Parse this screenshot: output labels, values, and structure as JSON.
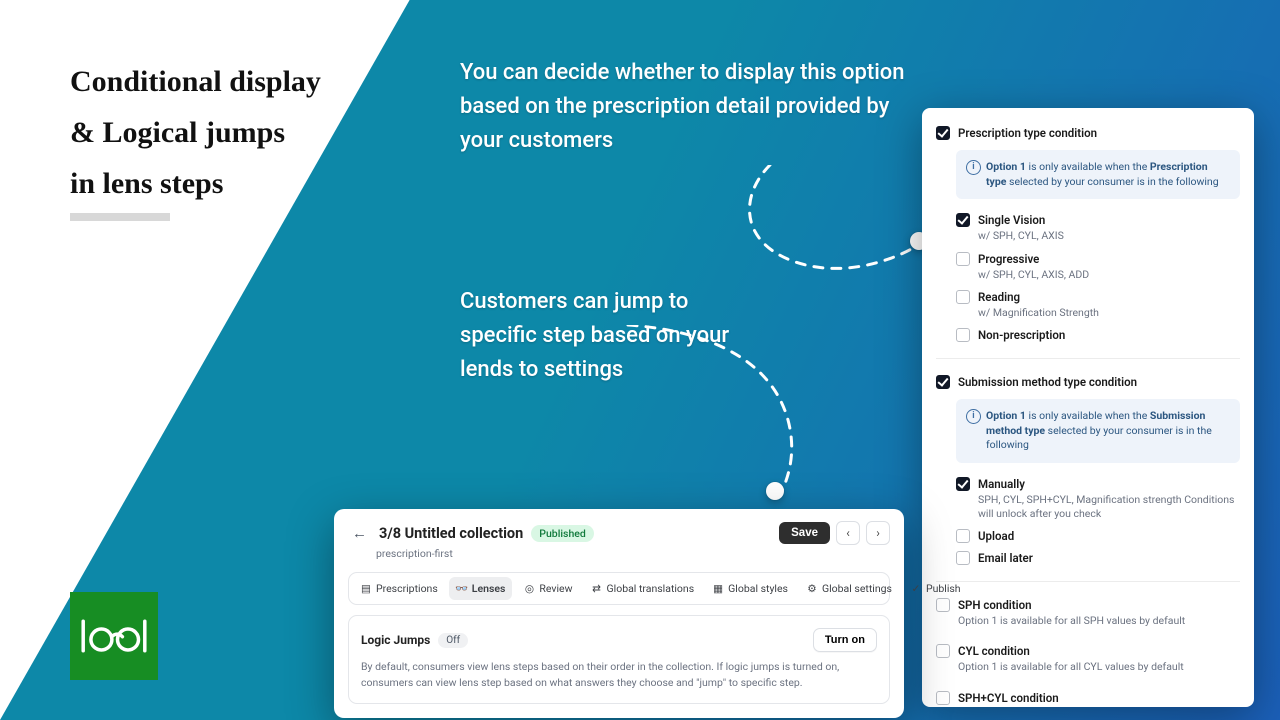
{
  "hero": {
    "title_l1": "Conditional display",
    "title_l2": "& Logical jumps",
    "title_l3": "in lens steps",
    "annot1": "You can decide whether to display this option based on the prescription detail provided by your customers",
    "annot2": "Customers can jump to specific step based on your lends to settings"
  },
  "conditions": {
    "presc_label": "Prescription type condition",
    "presc_info_before": "Option 1",
    "presc_info_mid": " is only available when the ",
    "presc_info_bold": "Prescription type",
    "presc_info_after": " selected by your consumer is in the following",
    "items": [
      {
        "label": "Single Vision",
        "sub": "w/ SPH, CYL, AXIS",
        "checked": true
      },
      {
        "label": "Progressive",
        "sub": "w/ SPH, CYL, AXIS, ADD",
        "checked": false
      },
      {
        "label": "Reading",
        "sub": "w/ Magnification Strength",
        "checked": false
      },
      {
        "label": "Non-prescription",
        "sub": "",
        "checked": false
      }
    ],
    "submit_label": "Submission method type condition",
    "submit_info_before": "Option 1",
    "submit_info_mid": " is only available when the ",
    "submit_info_bold": "Submission method type",
    "submit_info_after": " selected by your consumer is in the following",
    "submit_items": [
      {
        "label": "Manually",
        "sub": "SPH, CYL, SPH+CYL, Magnification strength Conditions will unlock after you check",
        "checked": true
      },
      {
        "label": "Upload",
        "sub": "",
        "checked": false
      },
      {
        "label": "Email later",
        "sub": "",
        "checked": false
      }
    ],
    "extra": [
      {
        "label": "SPH condition",
        "sub": "Option 1 is available for all SPH values by default"
      },
      {
        "label": "CYL condition",
        "sub": "Option 1 is available for all CYL values by default"
      },
      {
        "label": "SPH+CYL condition",
        "sub": ""
      }
    ]
  },
  "collection": {
    "title": "3/8 Untitled collection",
    "status": "Published",
    "slug": "prescription-first",
    "save": "Save",
    "tabs": {
      "presc": "Prescriptions",
      "lenses": "Lenses",
      "review": "Review",
      "gtrans": "Global translations",
      "gstyles": "Global styles",
      "gsettings": "Global settings",
      "publish": "Publish"
    },
    "logic": {
      "title": "Logic Jumps",
      "state": "Off",
      "turn_on": "Turn on",
      "desc": "By default, consumers view lens steps based on their order in the collection. If logic jumps is turned on, consumers can view lens step based on what answers they choose and \"jump\" to specific step."
    }
  }
}
